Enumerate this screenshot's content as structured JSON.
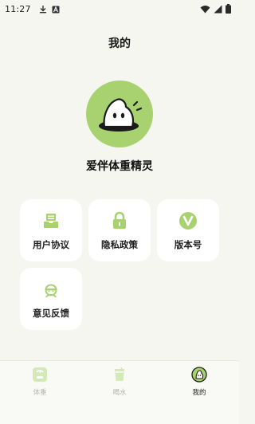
{
  "status_bar": {
    "time": "11:27",
    "left_icons": [
      "download-icon",
      "a-badge-icon"
    ],
    "right_icons": [
      "wifi-icon",
      "signal-icon",
      "battery-icon"
    ]
  },
  "header": {
    "title": "我的"
  },
  "profile": {
    "avatar_icon": "ghost-mascot-icon",
    "name": "爱伴体重精灵"
  },
  "menu": [
    {
      "label": "用户协议",
      "icon": "document-tray-icon"
    },
    {
      "label": "隐私政策",
      "icon": "lock-icon"
    },
    {
      "label": "版本号",
      "icon": "version-v-icon"
    },
    {
      "label": "意见反馈",
      "icon": "feedback-person-icon"
    }
  ],
  "tabbar": {
    "tabs": [
      {
        "label": "体重",
        "icon": "scale-icon",
        "active": false
      },
      {
        "label": "喝水",
        "icon": "water-cup-icon",
        "active": false
      },
      {
        "label": "我的",
        "icon": "profile-icon",
        "active": true
      }
    ]
  },
  "colors": {
    "accent_green": "#a8d270",
    "background": "#f6f6f1",
    "card": "#ffffff",
    "dark": "#1e1e1e"
  }
}
